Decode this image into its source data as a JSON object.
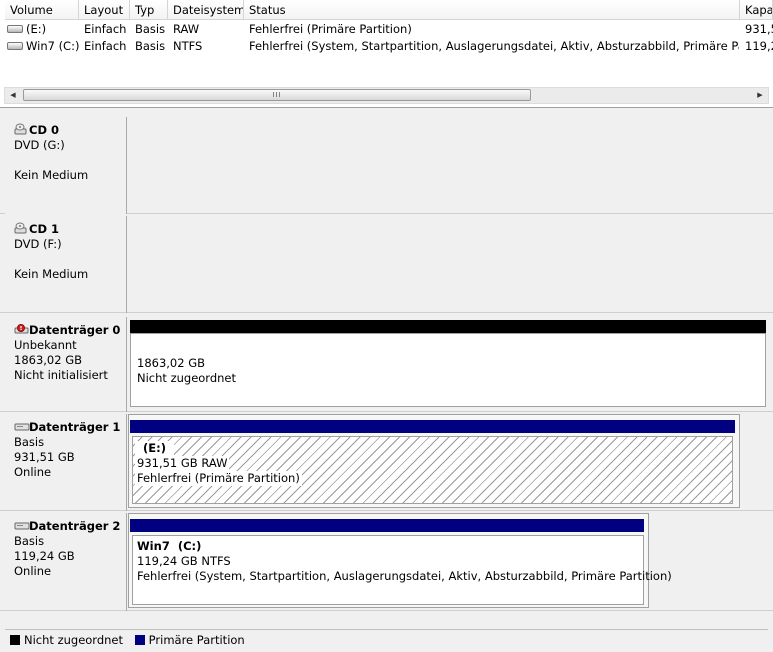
{
  "columns": [
    "Volume",
    "Layout",
    "Typ",
    "Dateisystem",
    "Status",
    "Kapa"
  ],
  "rows": [
    {
      "volume": "(E:)",
      "layout": "Einfach",
      "typ": "Basis",
      "fs": "RAW",
      "status": "Fehlerfrei (Primäre Partition)",
      "kap": "931,5"
    },
    {
      "volume": "Win7 (C:)",
      "layout": "Einfach",
      "typ": "Basis",
      "fs": "NTFS",
      "status": "Fehlerfrei (System, Startpartition, Auslagerungsdatei, Aktiv, Absturzabbild, Primäre Partition)",
      "kap": "119,2"
    }
  ],
  "scrollbar": {
    "left_arrow": "◀",
    "right_arrow": "▶",
    "grip": "III"
  },
  "disks": [
    {
      "name": "CD 0",
      "lines": [
        "DVD (G:)",
        "",
        "Kein Medium"
      ],
      "icon": "cd-drive-icon"
    },
    {
      "name": "CD 1",
      "lines": [
        "DVD (F:)",
        "",
        "Kein Medium"
      ],
      "icon": "cd-drive-icon"
    },
    {
      "name": "Datenträger 0",
      "lines": [
        "Unbekannt",
        "1863,02 GB",
        "Nicht initialisiert"
      ],
      "icon": "disk-error-icon",
      "partition": {
        "title": "",
        "size": "1863,02 GB",
        "status": "Nicht zugeordnet",
        "bar_color": "#000000"
      }
    },
    {
      "name": "Datenträger 1",
      "lines": [
        "Basis",
        "931,51 GB",
        "Online"
      ],
      "icon": "disk-icon",
      "partition": {
        "title": "(E:)",
        "size": "931,51 GB RAW",
        "status": "Fehlerfrei (Primäre Partition)",
        "bar_color": "#000080"
      }
    },
    {
      "name": "Datenträger 2",
      "lines": [
        "Basis",
        "119,24 GB",
        "Online"
      ],
      "icon": "disk-icon",
      "partition": {
        "title": "Win7  (C:)",
        "size": "119,24 GB NTFS",
        "status": "Fehlerfrei (System, Startpartition, Auslagerungsdatei, Aktiv, Absturzabbild, Primäre Partition)",
        "bar_color": "#000080"
      }
    }
  ],
  "legend": [
    {
      "label": "Nicht zugeordnet",
      "color": "#000000"
    },
    {
      "label": "Primäre Partition",
      "color": "#000080"
    }
  ]
}
